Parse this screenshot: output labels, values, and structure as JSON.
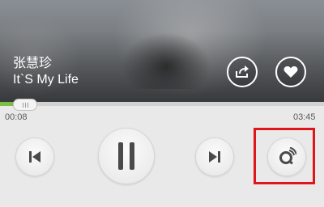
{
  "now_playing": {
    "artist": "张慧珍",
    "title": "It`S My Life"
  },
  "progress": {
    "current_time": "00:08",
    "duration": "03:45",
    "fraction": 0.06
  },
  "icons": {
    "share": "share-icon",
    "favorite": "heart-icon",
    "previous": "skip-previous-icon",
    "pause": "pause-icon",
    "next": "skip-next-icon",
    "play_mode": "play-mode-icon"
  },
  "colors": {
    "progress": "#7bc043",
    "highlight": "#e0161b"
  }
}
